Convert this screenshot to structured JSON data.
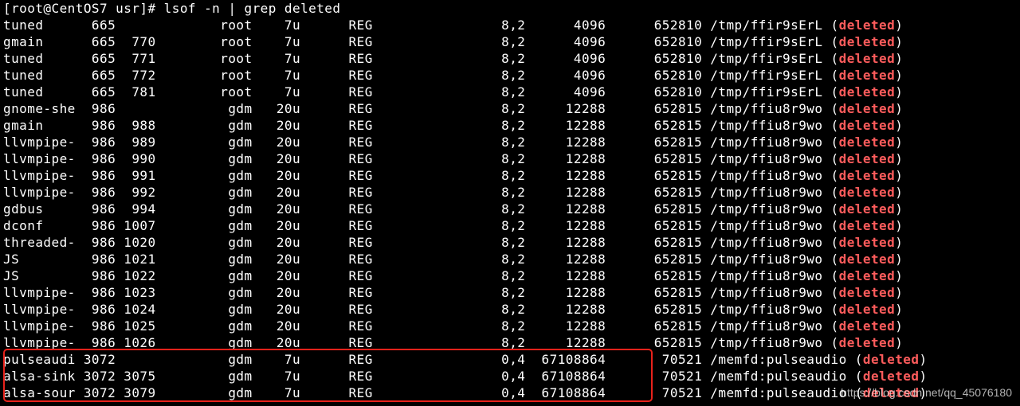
{
  "terminal": {
    "command_line": "[root@CentOS7 usr]# lsof -n | grep deleted",
    "deleted_label": "deleted",
    "rows": [
      {
        "pre": "tuned      665             root    7u      REG                8,2      4096      652810 /tmp/ffir9sErL (",
        "post": ")"
      },
      {
        "pre": "gmain      665  770        root    7u      REG                8,2      4096      652810 /tmp/ffir9sErL (",
        "post": ")"
      },
      {
        "pre": "tuned      665  771        root    7u      REG                8,2      4096      652810 /tmp/ffir9sErL (",
        "post": ")"
      },
      {
        "pre": "tuned      665  772        root    7u      REG                8,2      4096      652810 /tmp/ffir9sErL (",
        "post": ")"
      },
      {
        "pre": "tuned      665  781        root    7u      REG                8,2      4096      652810 /tmp/ffir9sErL (",
        "post": ")"
      },
      {
        "pre": "gnome-she  986              gdm   20u      REG                8,2     12288      652815 /tmp/ffiu8r9wo (",
        "post": ")"
      },
      {
        "pre": "gmain      986  988         gdm   20u      REG                8,2     12288      652815 /tmp/ffiu8r9wo (",
        "post": ")"
      },
      {
        "pre": "llvmpipe-  986  989         gdm   20u      REG                8,2     12288      652815 /tmp/ffiu8r9wo (",
        "post": ")"
      },
      {
        "pre": "llvmpipe-  986  990         gdm   20u      REG                8,2     12288      652815 /tmp/ffiu8r9wo (",
        "post": ")"
      },
      {
        "pre": "llvmpipe-  986  991         gdm   20u      REG                8,2     12288      652815 /tmp/ffiu8r9wo (",
        "post": ")"
      },
      {
        "pre": "llvmpipe-  986  992         gdm   20u      REG                8,2     12288      652815 /tmp/ffiu8r9wo (",
        "post": ")"
      },
      {
        "pre": "gdbus      986  994         gdm   20u      REG                8,2     12288      652815 /tmp/ffiu8r9wo (",
        "post": ")"
      },
      {
        "pre": "dconf      986 1007         gdm   20u      REG                8,2     12288      652815 /tmp/ffiu8r9wo (",
        "post": ")"
      },
      {
        "pre": "threaded-  986 1020         gdm   20u      REG                8,2     12288      652815 /tmp/ffiu8r9wo (",
        "post": ")"
      },
      {
        "pre": "JS         986 1021         gdm   20u      REG                8,2     12288      652815 /tmp/ffiu8r9wo (",
        "post": ")"
      },
      {
        "pre": "JS         986 1022         gdm   20u      REG                8,2     12288      652815 /tmp/ffiu8r9wo (",
        "post": ")"
      },
      {
        "pre": "llvmpipe-  986 1023         gdm   20u      REG                8,2     12288      652815 /tmp/ffiu8r9wo (",
        "post": ")"
      },
      {
        "pre": "llvmpipe-  986 1024         gdm   20u      REG                8,2     12288      652815 /tmp/ffiu8r9wo (",
        "post": ")"
      },
      {
        "pre": "llvmpipe-  986 1025         gdm   20u      REG                8,2     12288      652815 /tmp/ffiu8r9wo (",
        "post": ")"
      },
      {
        "pre": "llvmpipe-  986 1026         gdm   20u      REG                8,2     12288      652815 /tmp/ffiu8r9wo (",
        "post": ")"
      },
      {
        "pre": "pulseaudi 3072              gdm    7u      REG                0,4  67108864       70521 /memfd:pulseaudio (",
        "post": ")"
      },
      {
        "pre": "alsa-sink 3072 3075         gdm    7u      REG                0,4  67108864       70521 /memfd:pulseaudio (",
        "post": ")"
      },
      {
        "pre": "alsa-sour 3072 3079         gdm    7u      REG                0,4  67108864       70521 /memfd:pulseaudio (",
        "post": ")"
      }
    ],
    "watermark": "https://blog.csdn.net/qq_45076180"
  },
  "colors": {
    "background": "#000000",
    "text": "#ffffff",
    "deleted_highlight": "#ff5c5c",
    "annotation_box": "#e8221b"
  }
}
